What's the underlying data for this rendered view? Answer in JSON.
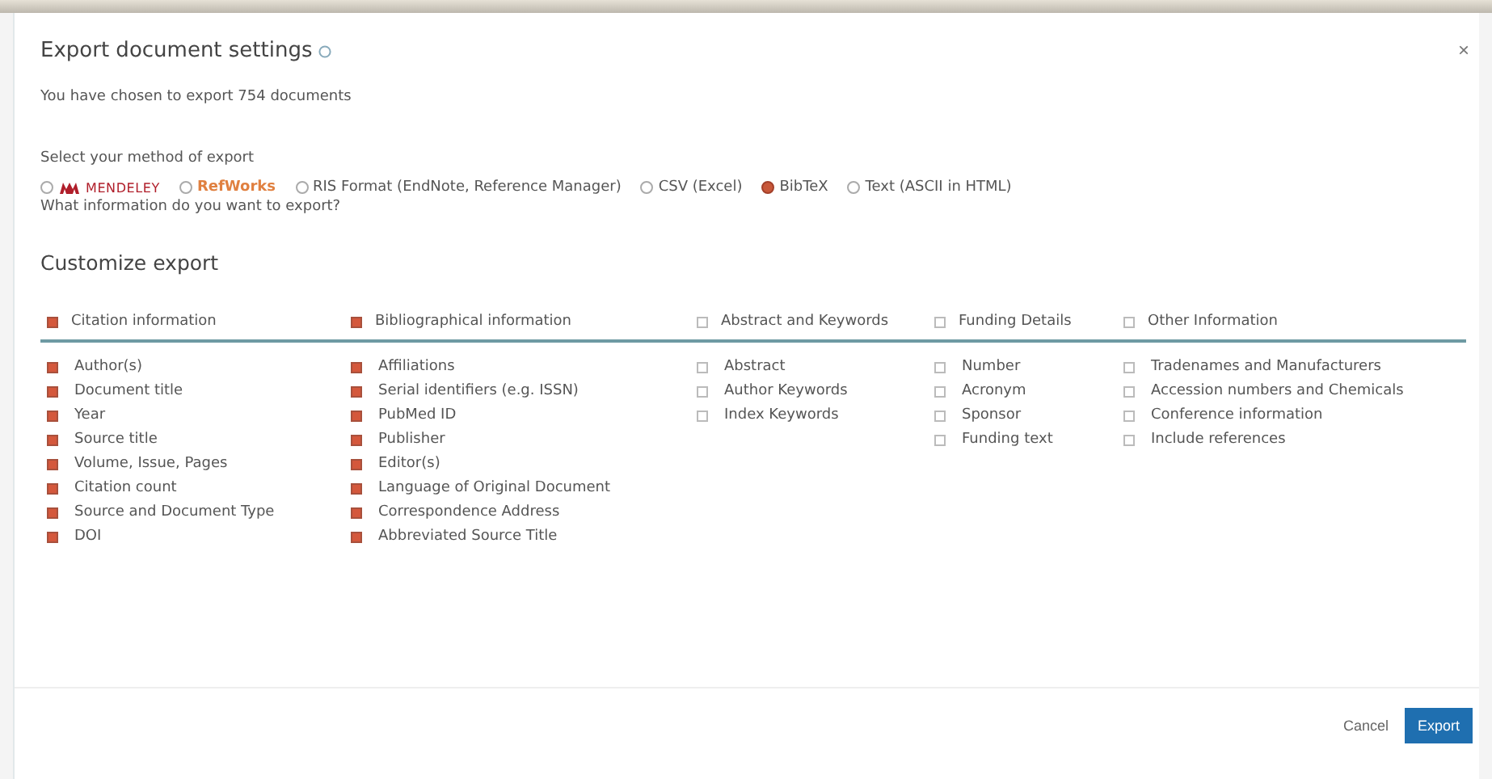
{
  "dialog": {
    "title": "Export document settings",
    "close": "×",
    "intro": "You have chosen to export 754 documents"
  },
  "export_method": {
    "label": "Select your method of export",
    "options": [
      {
        "kind": "mendeley",
        "label": "MENDELEY",
        "selected": false
      },
      {
        "kind": "refworks",
        "label": "RefWorks",
        "selected": false
      },
      {
        "kind": "text",
        "label": "RIS Format (EndNote, Reference Manager)",
        "selected": false
      },
      {
        "kind": "text",
        "label": "CSV (Excel)",
        "selected": false
      },
      {
        "kind": "text",
        "label": "BibTeX",
        "selected": true
      },
      {
        "kind": "text",
        "label": "Text (ASCII in HTML)",
        "selected": false
      }
    ]
  },
  "question": "What information do you want to export?",
  "customize": {
    "title": "Customize export",
    "groups": [
      {
        "label": "Citation information",
        "checked": true,
        "items": [
          {
            "label": "Author(s)",
            "checked": true
          },
          {
            "label": "Document title",
            "checked": true
          },
          {
            "label": "Year",
            "checked": true
          },
          {
            "label": "Source title",
            "checked": true
          },
          {
            "label": "Volume, Issue, Pages",
            "checked": true
          },
          {
            "label": "Citation count",
            "checked": true
          },
          {
            "label": "Source and Document Type",
            "checked": true
          },
          {
            "label": "DOI",
            "checked": true
          }
        ]
      },
      {
        "label": "Bibliographical information",
        "checked": true,
        "items": [
          {
            "label": "Affiliations",
            "checked": true
          },
          {
            "label": "Serial identifiers (e.g. ISSN)",
            "checked": true
          },
          {
            "label": "PubMed ID",
            "checked": true
          },
          {
            "label": "Publisher",
            "checked": true
          },
          {
            "label": "Editor(s)",
            "checked": true
          },
          {
            "label": "Language of Original Document",
            "checked": true
          },
          {
            "label": "Correspondence Address",
            "checked": true
          },
          {
            "label": "Abbreviated Source Title",
            "checked": true
          }
        ]
      },
      {
        "label": "Abstract and Keywords",
        "checked": false,
        "items": [
          {
            "label": "Abstract",
            "checked": false
          },
          {
            "label": "Author Keywords",
            "checked": false
          },
          {
            "label": "Index Keywords",
            "checked": false
          }
        ]
      },
      {
        "label": "Funding Details",
        "checked": false,
        "items": [
          {
            "label": "Number",
            "checked": false
          },
          {
            "label": "Acronym",
            "checked": false
          },
          {
            "label": "Sponsor",
            "checked": false
          },
          {
            "label": "Funding text",
            "checked": false
          }
        ]
      },
      {
        "label": "Other Information",
        "checked": false,
        "items": [
          {
            "label": "Tradenames and Manufacturers",
            "checked": false
          },
          {
            "label": "Accession numbers and Chemicals",
            "checked": false
          },
          {
            "label": "Conference information",
            "checked": false
          },
          {
            "label": "Include references",
            "checked": false
          }
        ]
      }
    ]
  },
  "buttons": [
    {
      "kind": "link",
      "label": "Cancel"
    },
    {
      "kind": "primary",
      "label": "Export"
    }
  ]
}
